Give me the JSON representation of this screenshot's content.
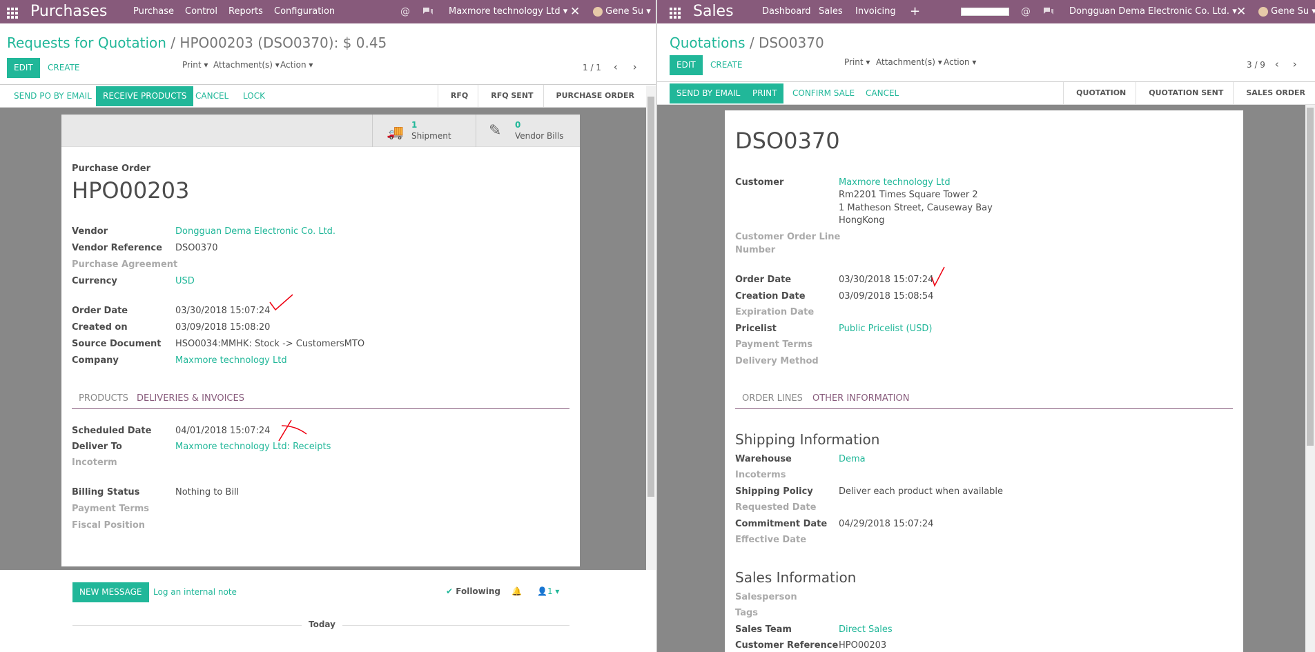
{
  "left": {
    "topbar": {
      "app_name": "Purchases",
      "menus": [
        "Purchase",
        "Control",
        "Reports",
        "Configuration"
      ],
      "company": "Maxmore technology Ltd",
      "user": "Gene Su"
    },
    "breadcrumb": {
      "parent": "Requests for Quotation",
      "sep": "/",
      "current": "HPO00203 (DSO0370): $ 0.45"
    },
    "buttons": {
      "edit": "EDIT",
      "create": "CREATE",
      "print": "Print",
      "attachments": "Attachment(s)",
      "action": "Action"
    },
    "pager": "1 / 1",
    "status_buttons": {
      "send_po": "SEND PO BY EMAIL",
      "receive": "RECEIVE PRODUCTS",
      "cancel": "CANCEL",
      "lock": "LOCK"
    },
    "stages": [
      "RFQ",
      "RFQ SENT",
      "PURCHASE ORDER"
    ],
    "smart_buttons": {
      "shipment_count": "1",
      "shipment_label": "Shipment",
      "bills_count": "0",
      "bills_label": "Vendor Bills"
    },
    "doc_type": "Purchase Order",
    "doc_name": "HPO00203",
    "fields": {
      "vendor_l": "Vendor",
      "vendor_v": "Dongguan Dema Electronic Co. Ltd.",
      "vendor_ref_l": "Vendor Reference",
      "vendor_ref_v": "DSO0370",
      "agreement_l": "Purchase Agreement",
      "currency_l": "Currency",
      "currency_v": "USD",
      "order_date_l": "Order Date",
      "order_date_v": "03/30/2018 15:07:24",
      "created_l": "Created on",
      "created_v": "03/09/2018 15:08:20",
      "source_l": "Source Document",
      "source_v": "HSO0034:MMHK: Stock -> CustomersMTO",
      "company_l": "Company",
      "company_v": "Maxmore technology Ltd"
    },
    "tabs": {
      "products": "PRODUCTS",
      "deliveries": "DELIVERIES & INVOICES"
    },
    "tab_fields": {
      "sched_l": "Scheduled Date",
      "sched_v": "04/01/2018 15:07:24",
      "deliver_l": "Deliver To",
      "deliver_v": "Maxmore technology Ltd: Receipts",
      "incoterm_l": "Incoterm",
      "billing_l": "Billing Status",
      "billing_v": "Nothing to Bill",
      "payterms_l": "Payment Terms",
      "fiscal_l": "Fiscal Position"
    },
    "chatter": {
      "new_message": "NEW MESSAGE",
      "log_note": "Log an internal note",
      "following": "Following",
      "followers": "1",
      "today": "Today"
    }
  },
  "right": {
    "topbar": {
      "app_name": "Sales",
      "menus": [
        "Dashboard",
        "Sales",
        "Invoicing"
      ],
      "company": "Dongguan Dema Electronic Co. Ltd.",
      "user": "Gene Su"
    },
    "breadcrumb": {
      "parent": "Quotations",
      "sep": "/",
      "current": "DSO0370"
    },
    "buttons": {
      "edit": "EDIT",
      "create": "CREATE",
      "print": "Print",
      "attachments": "Attachment(s)",
      "action": "Action"
    },
    "pager": "3 / 9",
    "status_buttons": {
      "send": "SEND BY EMAIL",
      "print": "PRINT",
      "confirm": "CONFIRM SALE",
      "cancel": "CANCEL"
    },
    "stages": [
      "QUOTATION",
      "QUOTATION SENT",
      "SALES ORDER"
    ],
    "doc_name": "DSO0370",
    "fields": {
      "customer_l": "Customer",
      "customer_v": "Maxmore technology Ltd",
      "addr1": "Rm2201 Times Square Tower 2",
      "addr2": "1 Matheson Street, Causeway Bay",
      "addr3": "HongKong",
      "col_l1": "Customer Order Line",
      "col_l2": "Number",
      "order_date_l": "Order Date",
      "order_date_v": "03/30/2018 15:07:24",
      "creation_l": "Creation Date",
      "creation_v": "03/09/2018 15:08:54",
      "expiration_l": "Expiration Date",
      "pricelist_l": "Pricelist",
      "pricelist_v": "Public Pricelist (USD)",
      "payterms_l": "Payment Terms",
      "delivery_l": "Delivery Method"
    },
    "tabs": {
      "order_lines": "ORDER LINES",
      "other": "OTHER INFORMATION"
    },
    "shipping": {
      "title": "Shipping Information",
      "warehouse_l": "Warehouse",
      "warehouse_v": "Dema",
      "incoterms_l": "Incoterms",
      "policy_l": "Shipping Policy",
      "policy_v": "Deliver each product when available",
      "requested_l": "Requested Date",
      "commitment_l": "Commitment Date",
      "commitment_v": "04/29/2018 15:07:24",
      "effective_l": "Effective Date"
    },
    "sales_info": {
      "title": "Sales Information",
      "salesperson_l": "Salesperson",
      "tags_l": "Tags",
      "team_l": "Sales Team",
      "team_v": "Direct Sales",
      "custref_l": "Customer Reference",
      "custref_v": "HPO00203"
    }
  }
}
